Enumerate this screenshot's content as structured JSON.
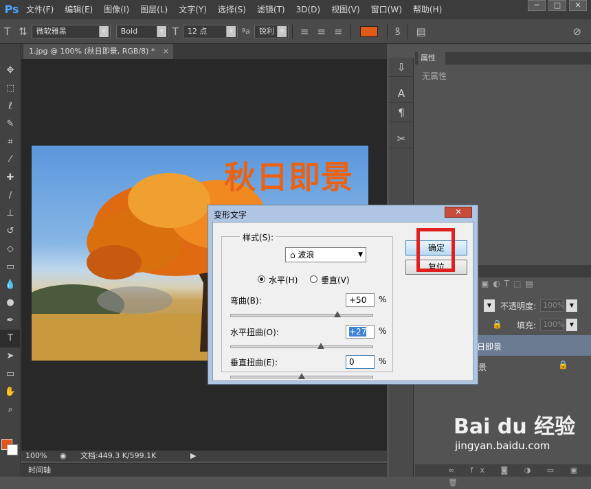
{
  "app": {
    "logo": "Ps",
    "menus": [
      "文件(F)",
      "编辑(E)",
      "图像(I)",
      "图层(L)",
      "文字(Y)",
      "选择(S)",
      "滤镜(T)",
      "3D(D)",
      "视图(V)",
      "窗口(W)",
      "帮助(H)"
    ],
    "window_buttons": [
      "─",
      "□",
      "✕"
    ]
  },
  "options": {
    "font_family": "微软雅黑",
    "font_style": "Bold",
    "font_size": "12 点",
    "aa_label": "ªa",
    "antialias": "锐利",
    "text_color": "#e05a1a"
  },
  "document": {
    "tab_title": "1.jpg @ 100% (秋日即景, RGB/8) *",
    "tab_close": "×",
    "wordart": "秋日即景",
    "zoom": "100%",
    "doc_info": "文档:449.3 K/599.1K",
    "timeline": "时间轴"
  },
  "panels": {
    "properties_tab": "属性",
    "properties_empty": "无属性",
    "opacity_label": "不透明度:",
    "opacity_value": "100%",
    "fill_label": "填充:",
    "fill_value": "100%",
    "layer1_label": "日即景",
    "layer2_label": "景"
  },
  "dialog": {
    "title": "变形文字",
    "close": "✕",
    "style_label": "样式(S):",
    "style_value": "⌂ 波浪",
    "horizontal_label": "水平(H)",
    "vertical_label": "垂直(V)",
    "orientation": "horizontal",
    "bend_label": "弯曲(B):",
    "bend_value": "+50",
    "hdist_label": "水平扭曲(O):",
    "hdist_value": "+27",
    "vdist_label": "垂直扭曲(E):",
    "vdist_value": "0",
    "percent": "%",
    "ok": "确定",
    "reset": "复位",
    "bend_level": 0.75,
    "hdist_level": 0.635,
    "vdist_level": 0.5
  },
  "watermark": {
    "brand": "Bai du 经验",
    "url": "jingyan.baidu.com"
  }
}
